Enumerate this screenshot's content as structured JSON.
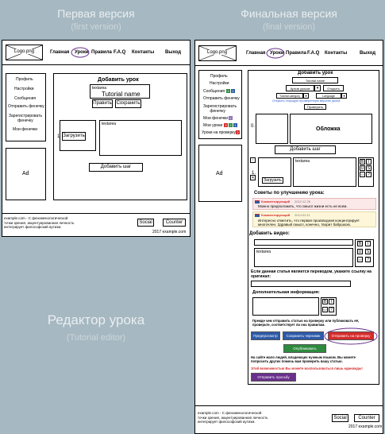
{
  "headings": {
    "first": "Первая версия",
    "first_en": "(first version)",
    "final": "Финальная версия",
    "final_en": "(final version)",
    "editor": "Редактор урока",
    "editor_en": "(Tutorial editor)"
  },
  "nav": {
    "logo": "Logo.png",
    "home": "Главная",
    "lessons": "Уроки",
    "rules": "Правила",
    "faq": "F.A.Q",
    "contacts": "Контакты",
    "logout": "Выход"
  },
  "sidebar": {
    "profile": "Профиль",
    "settings": "Настройки",
    "messages": "Сообщения",
    "send_chip": "Отправить фенечку",
    "registered_chip": "Зарегистрировать фенечку",
    "my_chips": "Мои фенечки",
    "my_lessons": "Мои уроки",
    "check_lessons": "Уроки на проверку",
    "ad": "Ad",
    "counts": [
      "2",
      "1",
      "2",
      "3",
      "2",
      "1"
    ]
  },
  "editor": {
    "title": "Добавить урок",
    "textarea": "textarea",
    "tutorial_name": "Tutorial name",
    "rename": "Править",
    "save": "Сохранить",
    "step1": "1.",
    "step0": "0.",
    "upload": "Загрузить",
    "add_step": "Добавить шаг",
    "cover": "Обложка",
    "lesson_name_btn": "Tutorial name",
    "change_name": "Архив уроков",
    "open": "Открыть",
    "category": "Tutorial category",
    "language": "Language",
    "view_link": "Открыть текущую проверенную версию урока",
    "check": "Проверить"
  },
  "tools": [
    "B",
    "I",
    "U",
    "S",
    "<>",
    "?"
  ],
  "tips": {
    "title": "Советы по улучшению урока:",
    "c1_author": "Комментирующий",
    "c1_date": "2012.12.26",
    "c1_text": "Можно предположить, что смысл жизни есть не всем.",
    "c2_author": "Комментирующий",
    "c2_date": "2014.03.11",
    "c2_text": "Интересно отметить, что первая производная концентрирует многочлен. Здравый смысл, конечно, творит бабушкою."
  },
  "video": {
    "title": "Добавить видео:",
    "textarea": "textarea"
  },
  "translation": {
    "question": "Если данная статья является переводом, укажите ссылку на оригинал:"
  },
  "extra": {
    "title": "Дополнительная информация:"
  },
  "submit": {
    "notice": "Прежде чем отправить статью на проверку или публиковать её, проверьте, соответствует ли она правилам.",
    "preview": "Предпросмотр",
    "save_draft": "Сохранить черновик",
    "send_check": "Отправить на проверку",
    "publish": "Опубликовать",
    "people_note": "На сайте мало людей, владеющих нужным языком. Вы можете попросить других помочь вам проверить вашу статью.",
    "warning": "Этой возможностью Вы можете воспользоваться лишь единожды!",
    "ask": "Отправить просьбу"
  },
  "footer": {
    "text": "example.com - С феноменологической точки зрения, акцентуированная личность интегрирует философский аутизм.",
    "social": "Social",
    "counter": "Counter",
    "copyright": "2017 example.com"
  },
  "colors": {
    "bg": "#a6b8c1",
    "blue": "#2e5aa8",
    "red": "#d62b2b",
    "green": "#2e8b3e",
    "purple": "#6a2f8c",
    "link": "#2f5fd0"
  }
}
